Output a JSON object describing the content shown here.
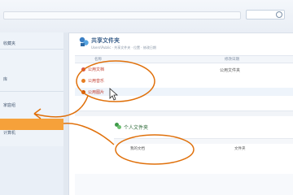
{
  "sidebar": {
    "items": [
      {
        "label": "收藏夹"
      },
      {
        "label": "库"
      },
      {
        "label": "家庭组"
      },
      {
        "label": "计算机"
      }
    ]
  },
  "main": {
    "group1": {
      "title": "共享文件夹",
      "subtitle": "Users\\Public · 共享文件夹 · 位置 · 修改日期",
      "columns": [
        "名称",
        "修改日期"
      ],
      "rows": [
        {
          "label": "公用文档"
        },
        {
          "label": "公用音乐"
        },
        {
          "label": "公用图片"
        }
      ],
      "right_label": "公用文件夹"
    },
    "group2": {
      "title": "个人文件夹",
      "row_label": "我的文档",
      "right_label": "文件夹"
    }
  },
  "colors": {
    "annotation": "#e0700a",
    "highlight": "#f6a13a",
    "title_blue": "#3a5f8a",
    "title_green": "#2f6b3a"
  }
}
